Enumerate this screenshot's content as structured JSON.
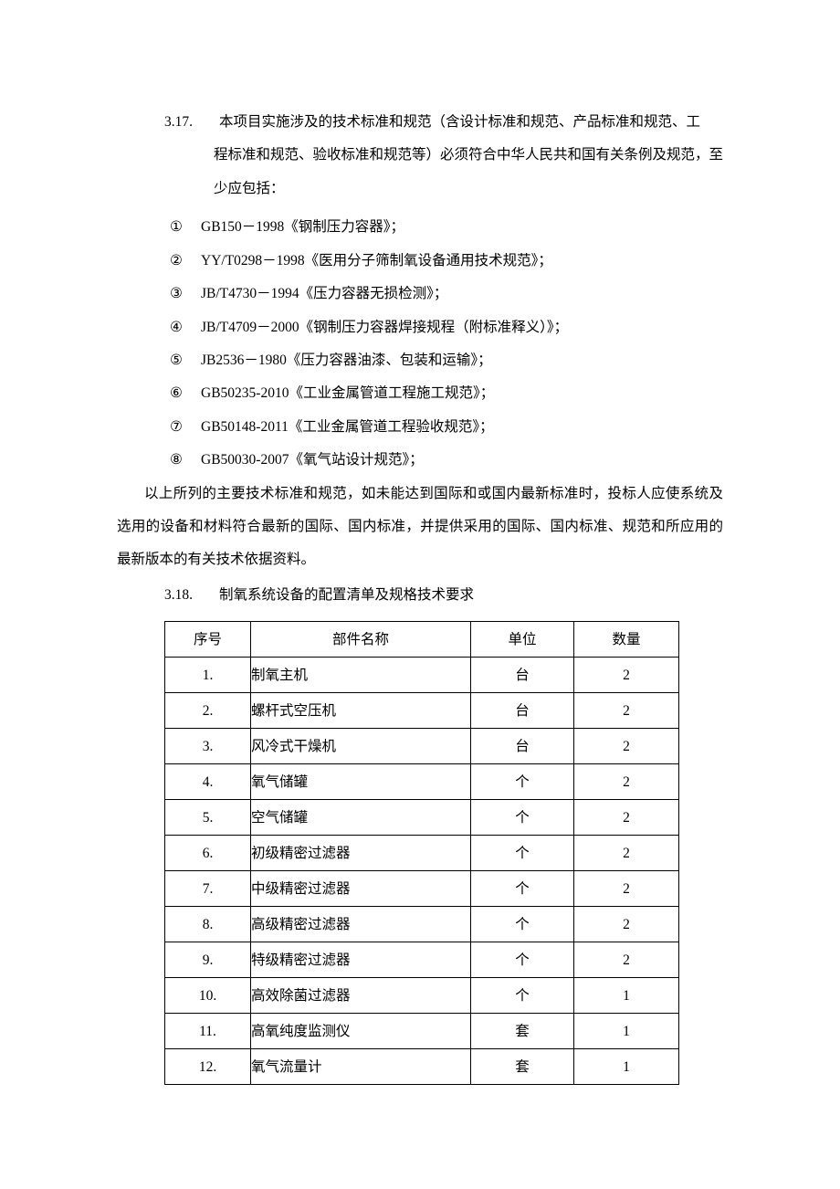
{
  "section317": {
    "number": "3.17.",
    "heading_segment1": "本项目实施涉及的技术标准和规范（含设计标准和规范、产品标准和规范、工",
    "heading_segment2": "程标准和规范、验收标准和规范等）必须符合中华人民共和国有关条例及规范，至少应包括：",
    "items": [
      {
        "marker": "①",
        "text": "GB150－1998《钢制压力容器》；"
      },
      {
        "marker": "②",
        "text": "YY/T0298－1998《医用分子筛制氧设备通用技术规范》；"
      },
      {
        "marker": "③",
        "text": "JB/T4730－1994《压力容器无损检测》；"
      },
      {
        "marker": "④",
        "text": "JB/T4709－2000《钢制压力容器焊接规程（附标准释义）》；"
      },
      {
        "marker": "⑤",
        "text": "JB2536－1980《压力容器油漆、包装和运输》；"
      },
      {
        "marker": "⑥",
        "text": "GB50235-2010《工业金属管道工程施工规范》；"
      },
      {
        "marker": "⑦",
        "text": "GB50148-2011《工业金属管道工程验收规范》；"
      },
      {
        "marker": "⑧",
        "text": "GB50030-2007《氧气站设计规范》；"
      }
    ],
    "closing": "以上所列的主要技术标准和规范，如未能达到国际和或国内最新标准时，投标人应使系统及选用的设备和材料符合最新的国际、国内标准，并提供采用的国际、国内标准、规范和所应用的最新版本的有关技术依据资料。"
  },
  "section318": {
    "number": "3.18.",
    "heading": "制氧系统设备的配置清单及规格技术要求",
    "table": {
      "headers": [
        "序号",
        "部件名称",
        "单位",
        "数量"
      ],
      "rows": [
        {
          "idx": "1.",
          "name": "制氧主机",
          "unit": "台",
          "qty": "2"
        },
        {
          "idx": "2.",
          "name": "螺杆式空压机",
          "unit": "台",
          "qty": "2"
        },
        {
          "idx": "3.",
          "name": "风冷式干燥机",
          "unit": "台",
          "qty": "2"
        },
        {
          "idx": "4.",
          "name": "氧气储罐",
          "unit": "个",
          "qty": "2"
        },
        {
          "idx": "5.",
          "name": "空气储罐",
          "unit": "个",
          "qty": "2"
        },
        {
          "idx": "6.",
          "name": "初级精密过滤器",
          "unit": "个",
          "qty": "2"
        },
        {
          "idx": "7.",
          "name": "中级精密过滤器",
          "unit": "个",
          "qty": "2"
        },
        {
          "idx": "8.",
          "name": "高级精密过滤器",
          "unit": "个",
          "qty": "2"
        },
        {
          "idx": "9.",
          "name": "特级精密过滤器",
          "unit": "个",
          "qty": "2"
        },
        {
          "idx": "10.",
          "name": "高效除菌过滤器",
          "unit": "个",
          "qty": "1"
        },
        {
          "idx": "11.",
          "name": "高氧纯度监测仪",
          "unit": "套",
          "qty": "1"
        },
        {
          "idx": "12.",
          "name": "氧气流量计",
          "unit": "套",
          "qty": "1"
        }
      ]
    }
  }
}
